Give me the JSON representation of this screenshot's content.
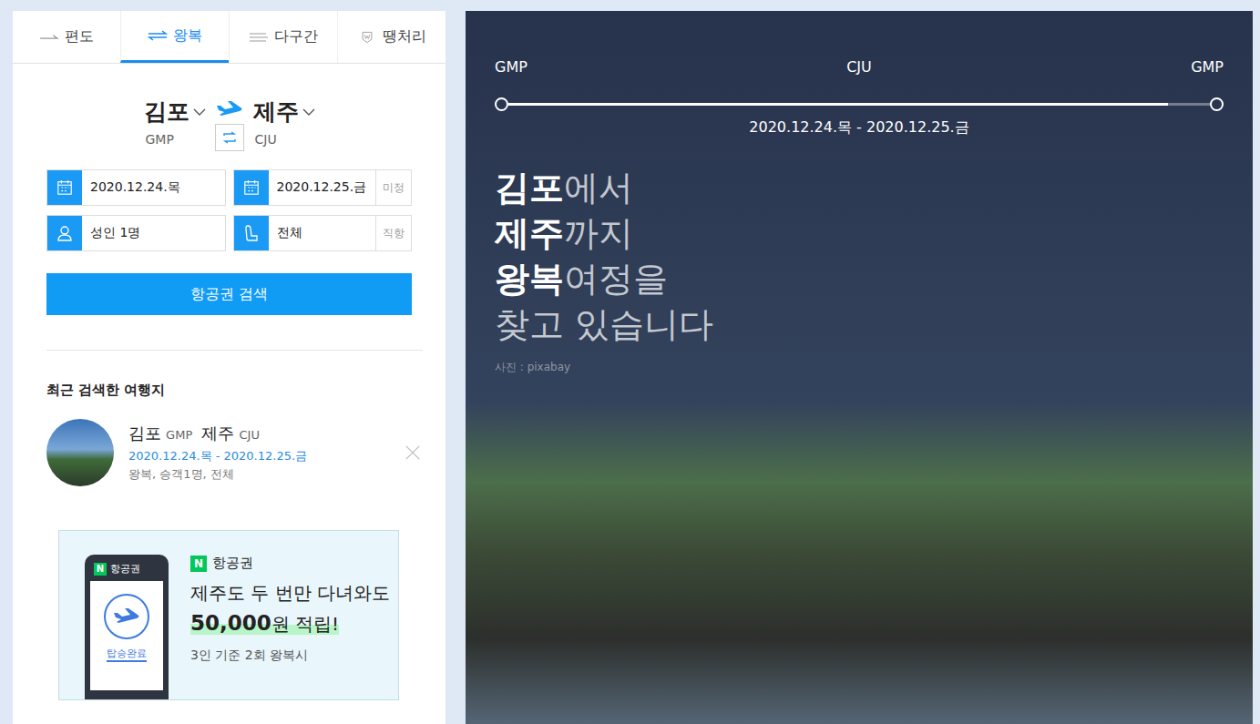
{
  "tabs": [
    {
      "label": "편도",
      "selected": false
    },
    {
      "label": "왕복",
      "selected": true
    },
    {
      "label": "다구간",
      "selected": false
    },
    {
      "label": "땡처리",
      "selected": false
    }
  ],
  "route": {
    "from": {
      "name": "김포",
      "code": "GMP"
    },
    "to": {
      "name": "제주",
      "code": "CJU"
    }
  },
  "fields": {
    "depart_date": "2020.12.24.목",
    "return_date": "2020.12.25.금",
    "undecided": "미정",
    "passengers": "성인 1명",
    "seat_class": "전체",
    "direct": "직항"
  },
  "search_button": "항공권 검색",
  "recent": {
    "title": "최근 검색한 여행지",
    "items": [
      {
        "from": "김포",
        "from_code": "GMP",
        "to": "제주",
        "to_code": "CJU",
        "dates": "2020.12.24.목 - 2020.12.25.금",
        "summary": "왕복, 승객1명, 전체"
      }
    ]
  },
  "banner": {
    "phone_badge": "N",
    "phone_title": "항공권",
    "phone_status": "탑승완료",
    "badge": "N",
    "title": "항공권",
    "line1": "제주도 두 번만 다녀와도",
    "amount": "50,000",
    "amount_suffix": "원 적립!",
    "note": "3인 기준 2회 왕복시"
  },
  "hero": {
    "stops": [
      "GMP",
      "CJU",
      "GMP"
    ],
    "progress": 0.94,
    "dates": "2020.12.24.목 - 2020.12.25.금",
    "lines": [
      {
        "bold": "김포",
        "rest": "에서"
      },
      {
        "bold": "제주",
        "rest": "까지"
      },
      {
        "bold": "왕복",
        "rest": "여정을"
      },
      {
        "bold": "",
        "rest": "찾고 있습니다"
      }
    ],
    "credit": "사진 : pixabay"
  }
}
